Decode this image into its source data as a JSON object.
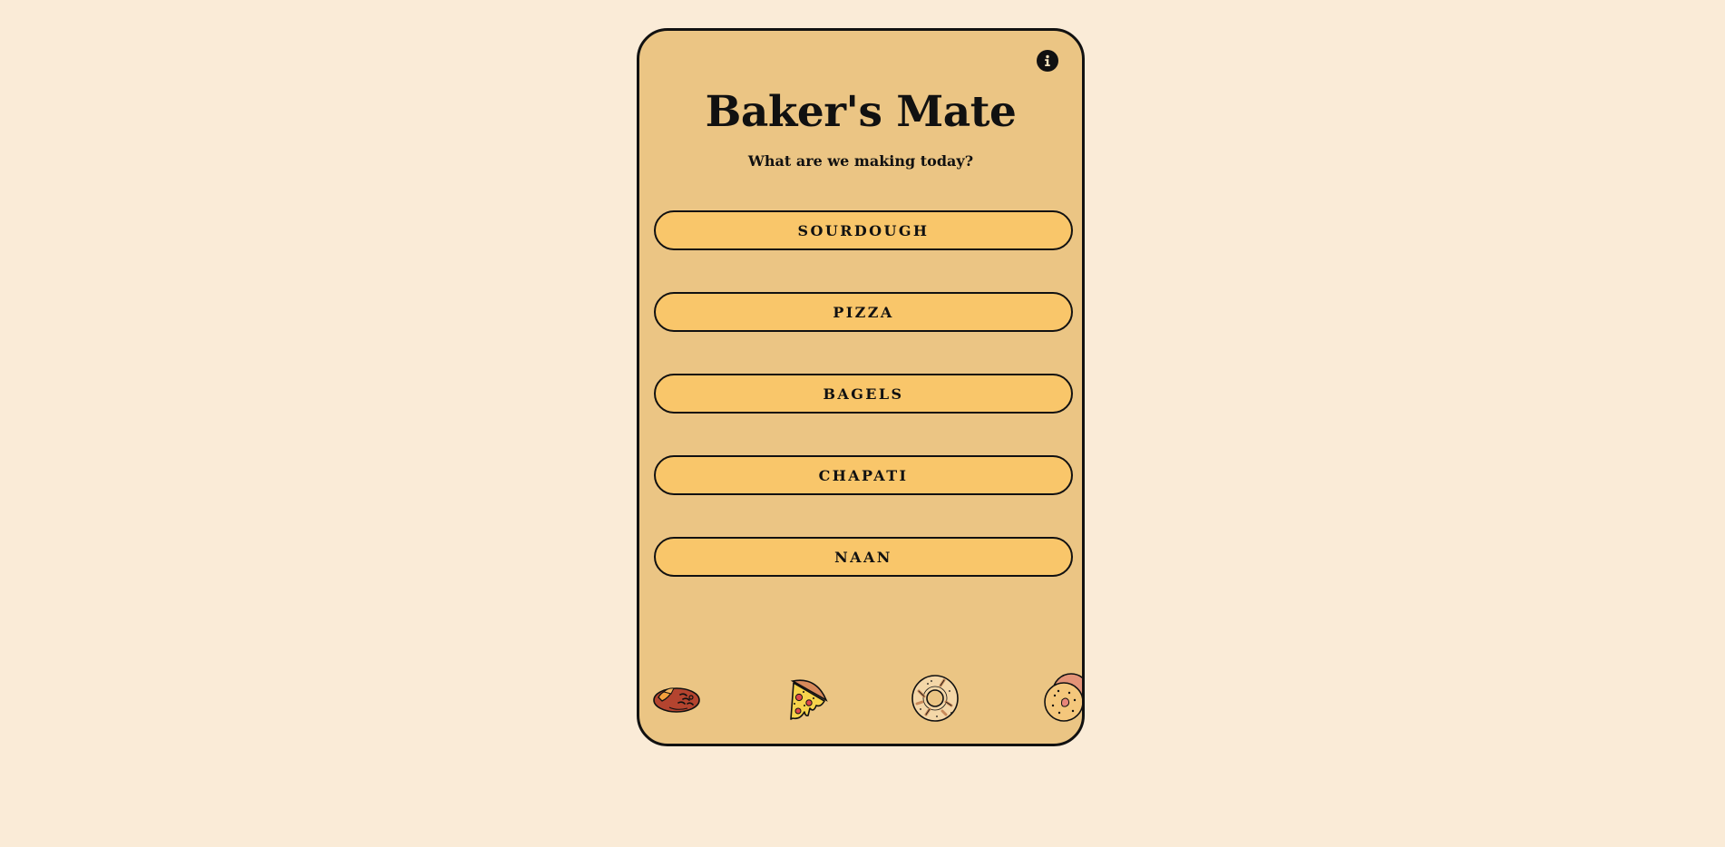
{
  "app": {
    "title": "Baker's Mate",
    "subtitle": "What are we making today?",
    "info_icon": "info-icon"
  },
  "menu": {
    "items": [
      {
        "label": "SOURDOUGH"
      },
      {
        "label": "PIZZA"
      },
      {
        "label": "BAGELS"
      },
      {
        "label": "CHAPATI"
      },
      {
        "label": "NAAN"
      }
    ]
  },
  "footer_icons": [
    "sourdough-loaf-icon",
    "pizza-slice-icon",
    "bagel-icon",
    "flatbread-icon"
  ],
  "colors": {
    "page_background": "#FAEBD7",
    "card_background": "#EBC584",
    "button_background": "#F9C66A",
    "outline": "#111111"
  }
}
